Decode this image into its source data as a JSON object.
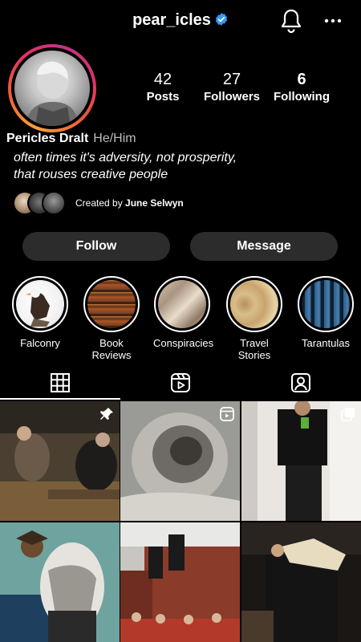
{
  "header": {
    "username": "pear_icles",
    "verified_icon": "verified-badge-icon",
    "notifications_icon": "bell-icon",
    "more_icon": "more-icon"
  },
  "profile": {
    "stats": [
      {
        "value": "42",
        "label": "Posts"
      },
      {
        "value": "27",
        "label": "Followers"
      },
      {
        "value": "6",
        "label": "Following"
      }
    ],
    "name": "Pericles Dralt",
    "pronouns": "He/Him",
    "bio_line1": "often times it's adversity, not prosperity,",
    "bio_line2": "that rouses creative people",
    "creator_prefix": "Created by",
    "creator_name": "June Selwyn"
  },
  "actions": {
    "follow": "Follow",
    "message": "Message"
  },
  "highlights": [
    {
      "label": "Falconry"
    },
    {
      "label": "Book",
      "label2": "Reviews"
    },
    {
      "label": "Conspiracies"
    },
    {
      "label": "Travel",
      "label2": "Stories"
    },
    {
      "label": "Tarantulas"
    }
  ],
  "tabs": [
    {
      "icon": "grid-icon",
      "active": true
    },
    {
      "icon": "reels-icon",
      "active": false
    },
    {
      "icon": "tagged-icon",
      "active": false
    }
  ],
  "colors": {
    "background": "#000000",
    "button": "#2c2c2c",
    "verified": "#3897f0"
  }
}
